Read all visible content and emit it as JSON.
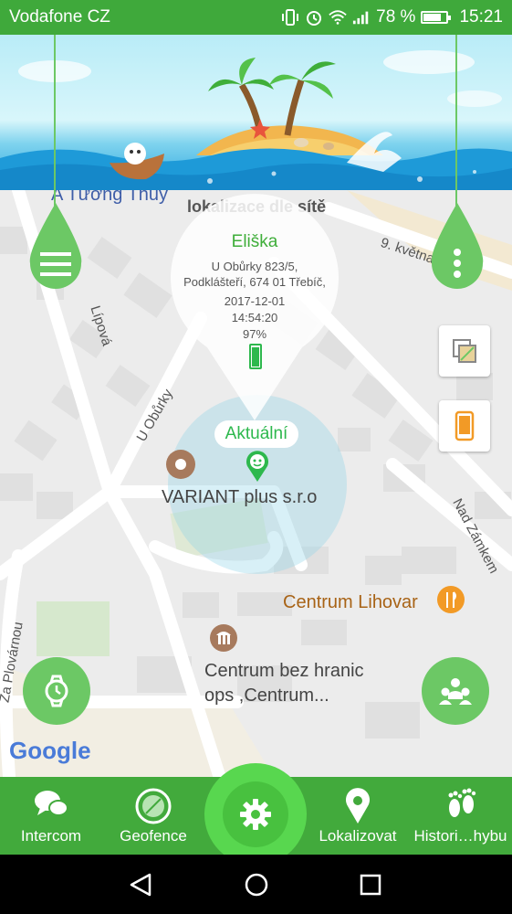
{
  "status_bar": {
    "carrier": "Vodafone CZ",
    "battery_percent": "78 %",
    "battery_level": 0.78,
    "time": "15:21",
    "icons": [
      "vibrate-icon",
      "alarm-icon",
      "wifi-icon",
      "signal-icon",
      "battery-icon"
    ]
  },
  "map": {
    "top_label_partial": "A Tương Thủy",
    "network_label": "lokalizace dle sítě",
    "streets": {
      "kvetna": "9. května",
      "lipova": "Lípová",
      "u_oburky": "U Obůrky",
      "nad_zamkem": "Nad Zámkem",
      "za_plovarnou": "Za Plovárnou"
    },
    "pois": {
      "variant": "VARIANT plus s.r.o",
      "lihovar": "Centrum Lihovar",
      "centrum_line1": "Centrum bez hranic",
      "centrum_line2": "ops ,Centrum..."
    },
    "google_logo": "Google"
  },
  "popup": {
    "name": "Eliška",
    "address_line1": "U Obůrky 823/5,",
    "address_line2": "Podklášteří, 674 01 Třebíč,",
    "date": "2017-12-01",
    "time": "14:54:20",
    "battery": "97%",
    "battery_level": 0.97
  },
  "current_marker": {
    "label": "Aktuální"
  },
  "bottom_nav": {
    "items": [
      {
        "label": "Intercom",
        "icon": "chat-bubbles-icon"
      },
      {
        "label": "Geofence",
        "icon": "geofence-icon"
      },
      {
        "label": "",
        "icon": "gear-icon"
      },
      {
        "label": "Lokalizovat",
        "icon": "location-pin-icon"
      },
      {
        "label": "Histori…hybu",
        "icon": "footprints-icon"
      }
    ]
  },
  "colors": {
    "primary_green": "#42aa3c",
    "status_green": "#3fa93b",
    "accent_green": "#6cc865",
    "marker_green": "#2db84d",
    "poi_orange": "#f29a26"
  }
}
